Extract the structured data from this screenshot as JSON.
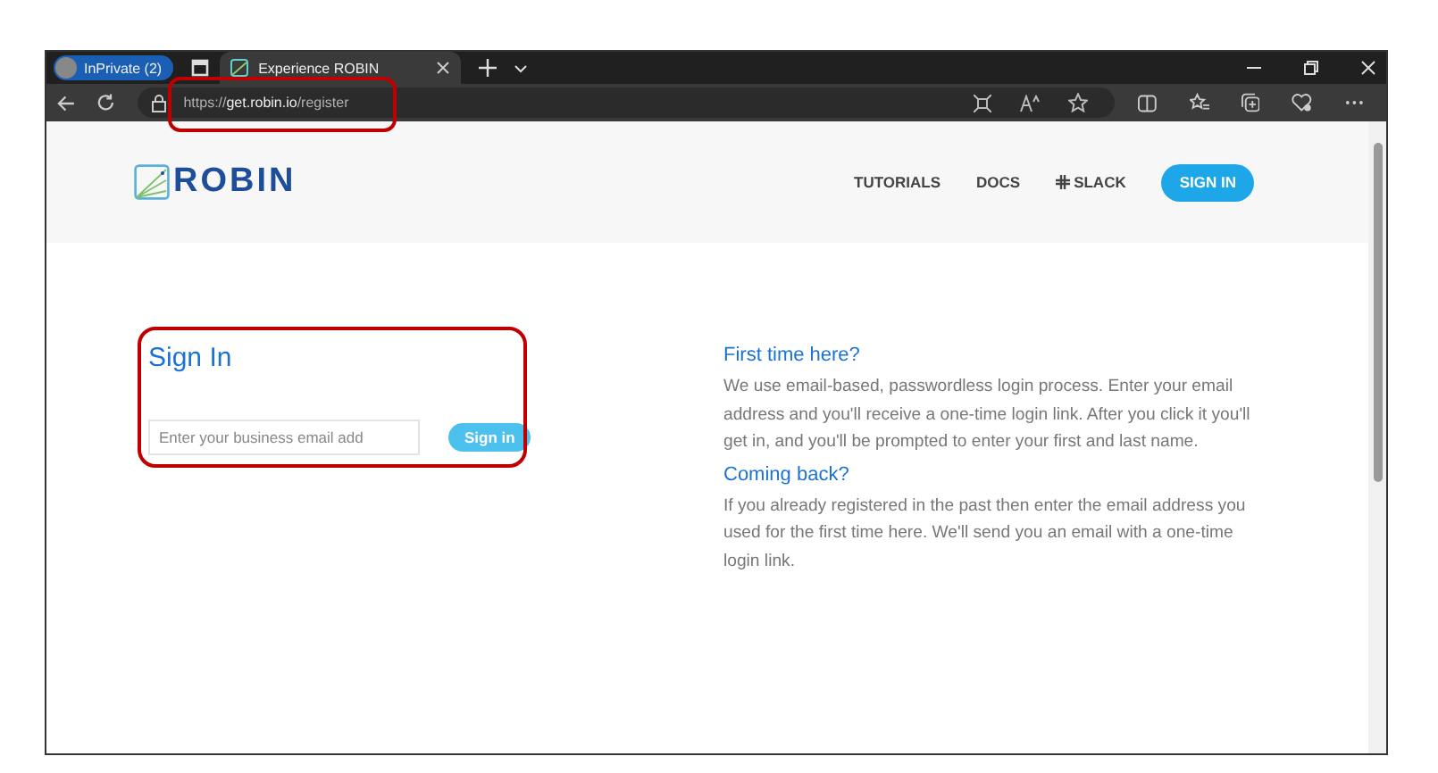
{
  "browser": {
    "profile": "InPrivate (2)",
    "tab_title": "Experience ROBIN",
    "url": "https://**get.robin.io**/register"
  },
  "site": {
    "brand": "ROBIN",
    "nav": [
      {
        "label": "TUTORIALS",
        "kind": "link"
      },
      {
        "label": "DOCS",
        "kind": "link"
      },
      {
        "label": "SLACK",
        "kind": "slack"
      },
      {
        "label": "SIGN IN",
        "kind": "button"
      }
    ]
  },
  "sign_in": {
    "title": "Sign In",
    "placeholder": "Enter your business email add",
    "button": "Sign in"
  },
  "info": [
    {
      "heading": "First time here?",
      "text": "We use email-based, passwordless login process. Enter your email address and you'll receive a one-time login link. After you click it you'll get in, and you'll be prompted to enter your first and last name."
    },
    {
      "heading": "Coming back?",
      "text": "If you already registered in the past then enter the email address you used for the first time here. We'll send you an email with a one-time login link."
    }
  ]
}
